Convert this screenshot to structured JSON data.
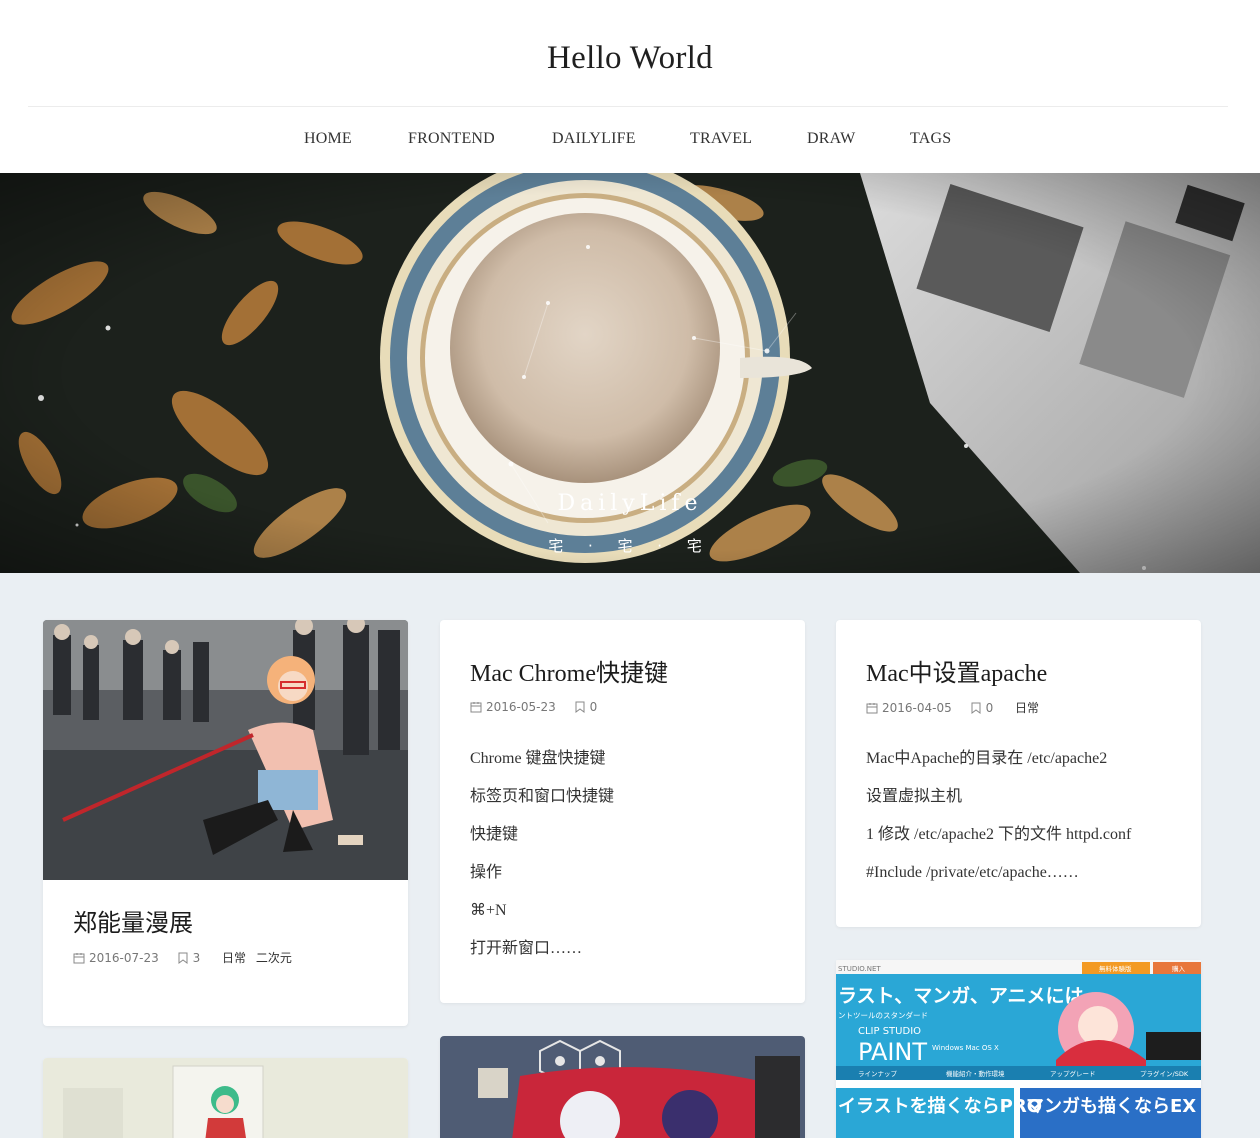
{
  "site": {
    "title": "Hello World"
  },
  "nav": [
    {
      "label": "HOME"
    },
    {
      "label": "FRONTEND"
    },
    {
      "label": "DAILYLIFE"
    },
    {
      "label": "TRAVEL"
    },
    {
      "label": "DRAW"
    },
    {
      "label": "TAGS"
    }
  ],
  "hero": {
    "title": "DailyLife",
    "subtitle": "宅 · 宅 · 宅"
  },
  "cards": [
    {
      "title": "郑能量漫展",
      "date": "2016-07-23",
      "comments": "3",
      "tags": [
        "日常",
        "二次元"
      ]
    },
    {
      "title": "Mac Chrome快捷键",
      "date": "2016-05-23",
      "comments": "0",
      "excerpt": [
        "Chrome 键盘快捷键",
        "标签页和窗口快捷键",
        "快捷键",
        "操作",
        "⌘+N",
        "打开新窗口……"
      ]
    },
    {
      "title": "Mac中设置apache",
      "date": "2016-04-05",
      "comments": "0",
      "tags": [
        "日常"
      ],
      "excerpt": [
        "Mac中Apache的目录在 /etc/apache2",
        "设置虚拟主机",
        "1 修改 /etc/apache2 下的文件 httpd.conf",
        "#Include /private/etc/apache……"
      ]
    }
  ],
  "promo": {
    "site": "STUDIO.NET",
    "headline": "ラスト、マンガ、アニメには。",
    "tagline": "ントツールのスタンダード",
    "product": "CLIP STUDIO",
    "product_big": "PAINT",
    "os": "Windows Mac OS X",
    "tabs": [
      "ラインナップ",
      "機能紹介・動作環境",
      "アップグレード",
      "プラグイン/SDK"
    ],
    "pro": "イラストを描くならPRO",
    "ex": "マンガも描くならEX",
    "btn_free": "無料体験版",
    "btn_buy": "購入"
  },
  "colors": {
    "page_bg": "#eaeff3",
    "card_bg": "#ffffff",
    "promo_blue": "#2aa7d6",
    "promo_orange": "#f39a23"
  }
}
